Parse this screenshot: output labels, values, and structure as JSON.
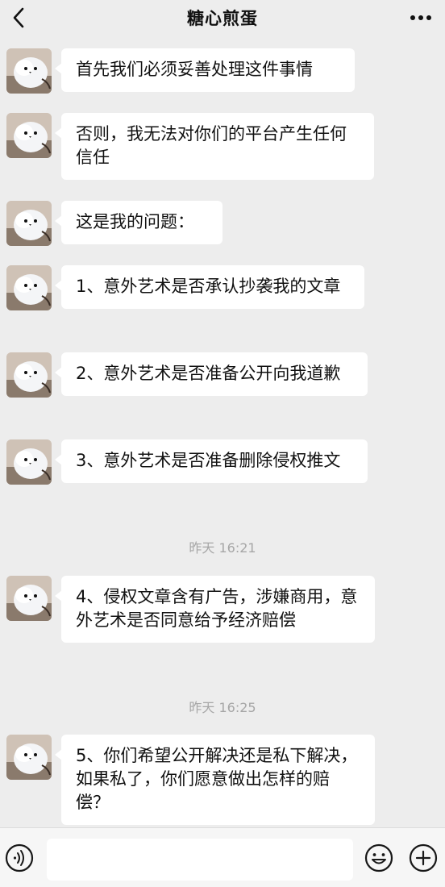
{
  "header": {
    "title": "糖心煎蛋",
    "back_icon": "chevron-left-icon",
    "more_icon": "ellipsis-icon"
  },
  "messages": [
    {
      "type": "text",
      "text": "首先我们必须妥善处理这件事情"
    },
    {
      "type": "text",
      "text": "否则，我无法对你们的平台产生任何信任"
    },
    {
      "type": "text",
      "text": "这是我的问题："
    },
    {
      "type": "text",
      "text": "1、意外艺术是否承认抄袭我的文章"
    },
    {
      "type": "text",
      "text": "2、意外艺术是否准备公开向我道歉"
    },
    {
      "type": "text",
      "text": "3、意外艺术是否准备删除侵权推文"
    },
    {
      "type": "time",
      "text": "昨天 16:21"
    },
    {
      "type": "text",
      "text": "4、侵权文章含有广告，涉嫌商用，意外艺术是否同意给予经济赔偿"
    },
    {
      "type": "time",
      "text": "昨天 16:25"
    },
    {
      "type": "text",
      "text": "5、你们希望公开解决还是私下解决，如果私了，你们愿意做出怎样的赔偿？"
    }
  ],
  "input": {
    "value": "",
    "voice_icon": "voice-icon",
    "emoji_icon": "emoji-icon",
    "plus_icon": "plus-icon"
  },
  "colors": {
    "background": "#ededed",
    "bubble": "#ffffff",
    "time_text": "#a6a6a6"
  }
}
